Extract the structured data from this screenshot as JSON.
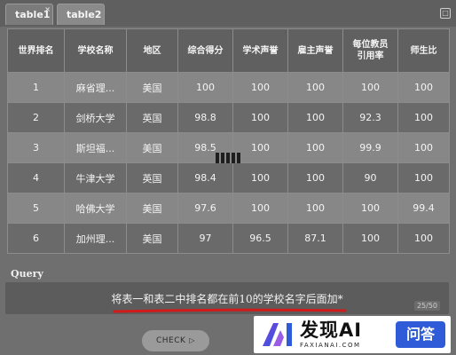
{
  "tabs": [
    {
      "label": "table1",
      "close": "×"
    },
    {
      "label": "table2"
    }
  ],
  "corner_icon": "□",
  "table": {
    "headers": [
      "世界排名",
      "学校名称",
      "地区",
      "综合得分",
      "学术声誉",
      "雇主声誉",
      "每位教员引用率",
      "师生比"
    ],
    "rows": [
      [
        "1",
        "麻省理...",
        "美国",
        "100",
        "100",
        "100",
        "100",
        "100"
      ],
      [
        "2",
        "剑桥大学",
        "英国",
        "98.8",
        "100",
        "100",
        "92.3",
        "100"
      ],
      [
        "3",
        "斯坦福...",
        "美国",
        "98.5",
        "100",
        "100",
        "99.9",
        "100"
      ],
      [
        "4",
        "牛津大学",
        "英国",
        "98.4",
        "100",
        "100",
        "90",
        "100"
      ],
      [
        "5",
        "哈佛大学",
        "美国",
        "97.6",
        "100",
        "100",
        "100",
        "99.4"
      ],
      [
        "6",
        "加州理...",
        "美国",
        "97",
        "96.5",
        "87.1",
        "100",
        "100"
      ]
    ]
  },
  "query": {
    "label": "Query",
    "text": "将表一和表二中排名都在前10的学校名字后面加*",
    "counter": "25/50"
  },
  "check_button": {
    "label": "CHECK",
    "icon": "play-icon"
  },
  "watermark": {
    "main": "发现AI",
    "sub": "FAXIANAI.COM",
    "badge": "问答"
  },
  "colors": {
    "underline": "#d11a1a",
    "badge": "#2f5bd8"
  }
}
